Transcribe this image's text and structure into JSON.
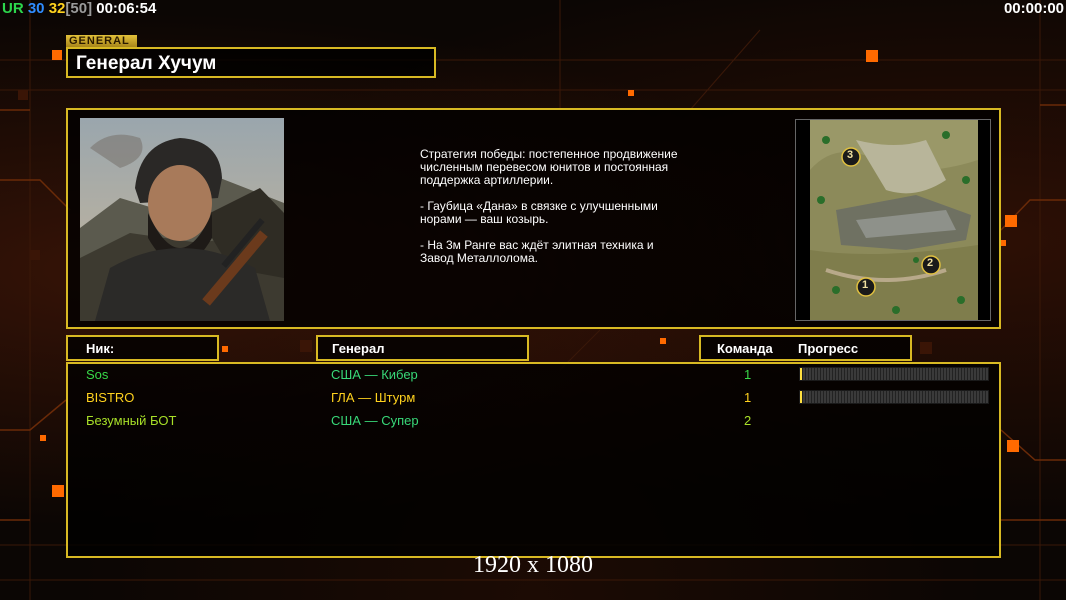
{
  "hud": {
    "ur_label": "UR",
    "blue_count": "30",
    "yellow_count": "32",
    "bracket_count": "[50]",
    "elapsed_time": "00:06:54",
    "countdown_time": "00:00:00"
  },
  "general": {
    "tag_label": "GENERAL",
    "name": "Генерал Хучум"
  },
  "description": {
    "lines": [
      "Стратегия победы: постепенное продвижение численным перевесом юнитов и постоянная поддержка артиллерии.",
      "- Гаубица «Дана» в связке с улучшенными норами — ваш козырь.",
      "- На 3м Ранге вас ждёт элитная техника и Завод Металлолома."
    ]
  },
  "minimap": {
    "start_positions": [
      "3",
      "2",
      "1"
    ]
  },
  "table": {
    "headers": {
      "nick": "Ник:",
      "general": "Генерал",
      "team": "Команда",
      "progress": "Прогресс"
    },
    "rows": [
      {
        "nick": "Sos",
        "general": "США — Кибер",
        "team": "1",
        "progress": 0.01,
        "nick_color": "#38d848",
        "general_color": "#38d878",
        "team_color": "#38d848"
      },
      {
        "nick": "BISTRO",
        "general": "ГЛА — Штурм",
        "team": "1",
        "progress": 0.01,
        "nick_color": "#ffd21e",
        "general_color": "#ffd21e",
        "team_color": "#ffd21e"
      },
      {
        "nick": "Безумный БОТ",
        "general": "США — Супер",
        "team": "2",
        "progress": null,
        "nick_color": "#a8e028",
        "general_color": "#38d878",
        "team_color": "#a8e028"
      }
    ]
  },
  "footer": {
    "resolution": "1920 x 1080"
  },
  "colors": {
    "frame_border": "#d8b923",
    "accent_orange": "#ff6a00"
  }
}
